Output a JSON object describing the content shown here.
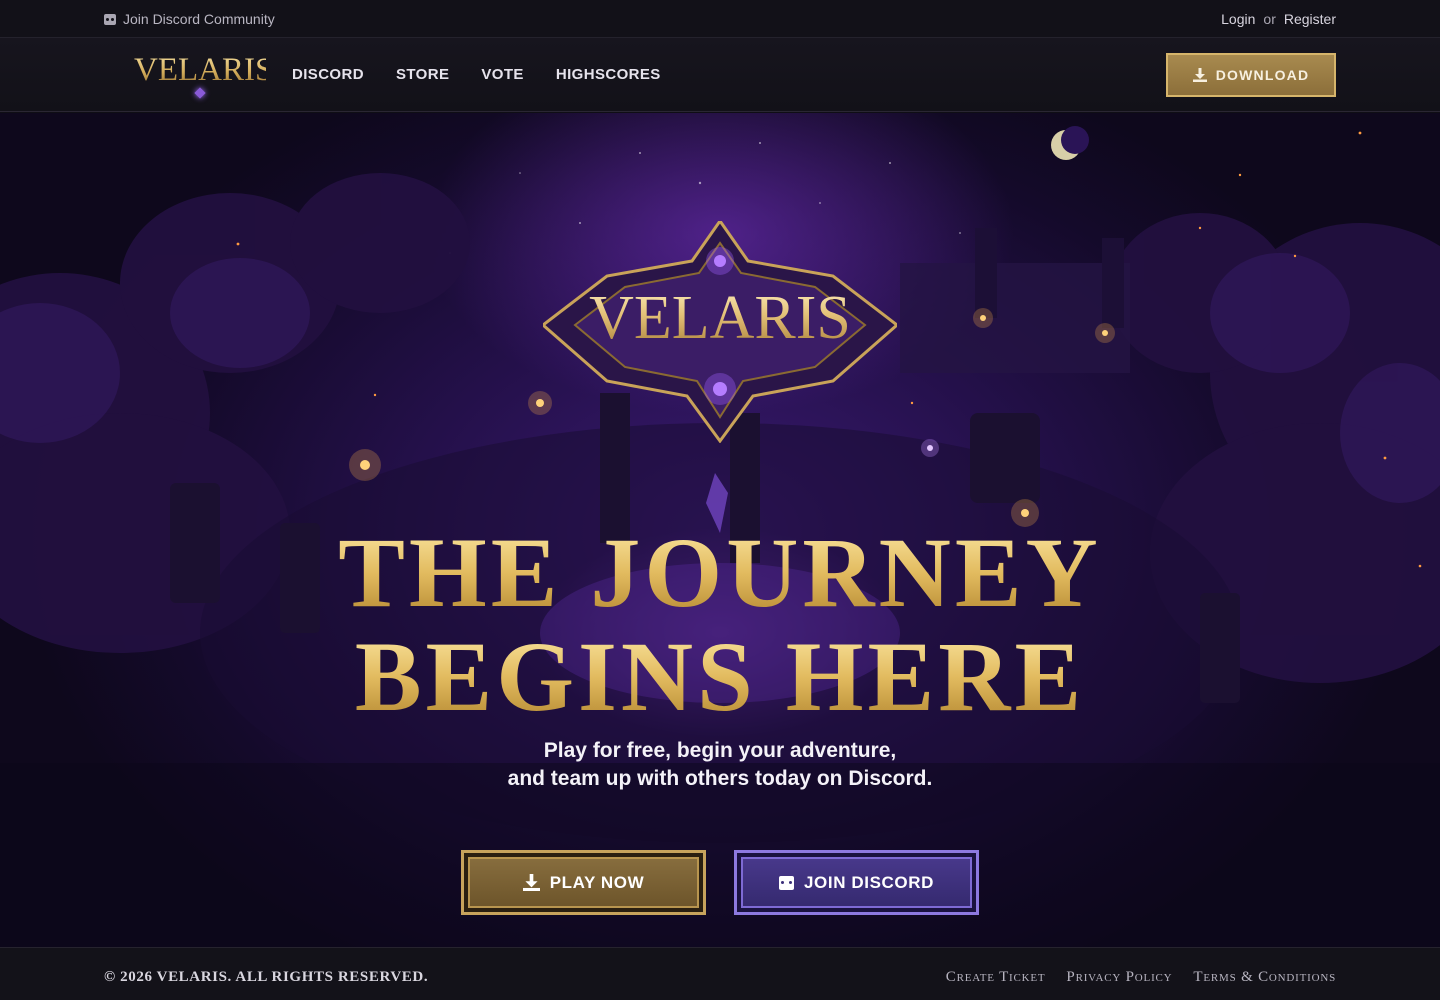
{
  "topbar": {
    "discord_label": "Join Discord Community",
    "login_label": "Login",
    "or_label": "or",
    "register_label": "Register"
  },
  "nav": {
    "brand": "VELARIS",
    "links": [
      "DISCORD",
      "STORE",
      "VOTE",
      "HIGHSCORES"
    ],
    "download_label": "DOWNLOAD"
  },
  "hero": {
    "crest_title": "VELARIS",
    "headline_line1": "THE JOURNEY",
    "headline_line2": "BEGINS HERE",
    "subline_line1": "Play for free, begin your adventure,",
    "subline_line2": "and team up with others today on Discord.",
    "play_label": "PLAY NOW",
    "discord_label": "JOIN DISCORD"
  },
  "footer": {
    "copyright": "© 2026 VELARIS. ALL RIGHTS RESERVED.",
    "links": [
      "Create Ticket",
      "Privacy Policy",
      "Terms & Conditions"
    ]
  },
  "colors": {
    "gold_accent": "#d6b56b",
    "purple_accent": "#8d79e0",
    "background": "#0f0e15"
  },
  "icons": {
    "discord": "discord-icon",
    "download": "download-icon",
    "moon": "moon-icon"
  }
}
